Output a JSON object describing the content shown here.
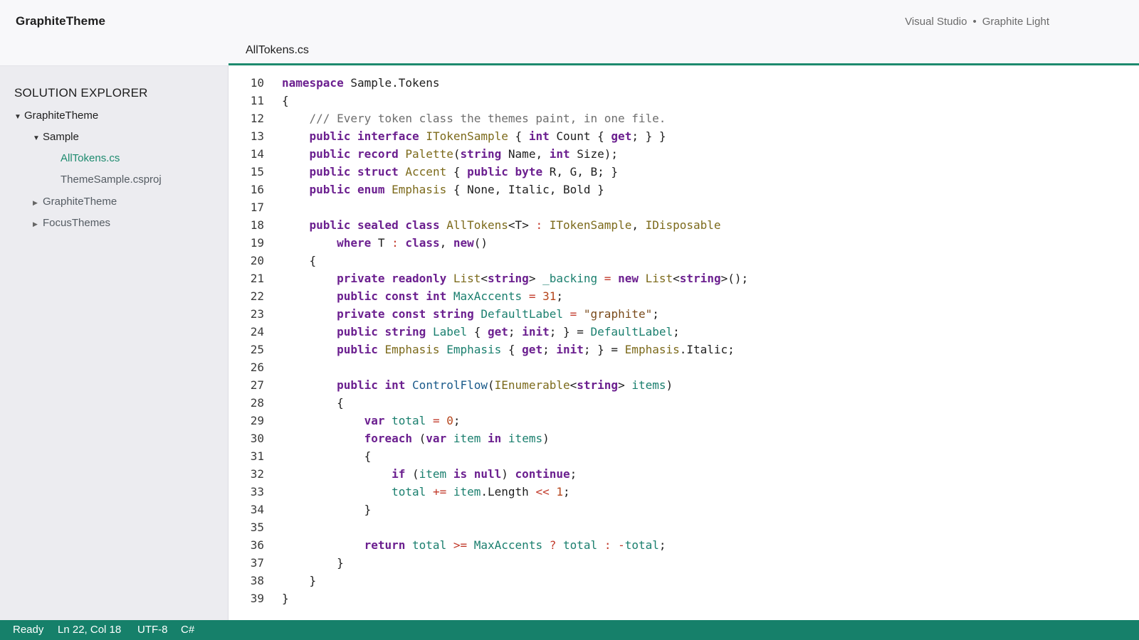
{
  "window": {
    "app_title": "GraphiteTheme",
    "ide": "Visual Studio",
    "separator": "•",
    "theme": "Graphite Light"
  },
  "tab": {
    "label": "AllTokens.cs"
  },
  "sidebar": {
    "title": "SOLUTION EXPLORER",
    "items": [
      {
        "label": "GraphiteTheme",
        "arrow": "▼"
      },
      {
        "label": "Sample",
        "arrow": "▼"
      },
      {
        "label": "AllTokens.cs",
        "arrow": ""
      },
      {
        "label": "ThemeSample.csproj",
        "arrow": ""
      },
      {
        "label": "GraphiteTheme",
        "arrow": "▶"
      },
      {
        "label": "FocusThemes",
        "arrow": "▶"
      }
    ]
  },
  "editor": {
    "lines": [
      {
        "n": "10",
        "tokens": [
          [
            "kw",
            "namespace"
          ],
          [
            "pl",
            " Sample.Tokens"
          ]
        ]
      },
      {
        "n": "11",
        "tokens": [
          [
            "pl",
            "{"
          ]
        ]
      },
      {
        "n": "12",
        "tokens": [
          [
            "com",
            "    /// Every token class the themes paint, in one file."
          ]
        ]
      },
      {
        "n": "13",
        "tokens": [
          [
            "pl",
            "    "
          ],
          [
            "kw",
            "public"
          ],
          [
            "pl",
            " "
          ],
          [
            "kw",
            "interface"
          ],
          [
            "pl",
            " "
          ],
          [
            "type",
            "ITokenSample"
          ],
          [
            "pl",
            " { "
          ],
          [
            "kw",
            "int"
          ],
          [
            "pl",
            " Count { "
          ],
          [
            "kw",
            "get"
          ],
          [
            "pl",
            "; } }"
          ]
        ]
      },
      {
        "n": "14",
        "tokens": [
          [
            "pl",
            "    "
          ],
          [
            "kw",
            "public"
          ],
          [
            "pl",
            " "
          ],
          [
            "kw",
            "record"
          ],
          [
            "pl",
            " "
          ],
          [
            "type",
            "Palette"
          ],
          [
            "pl",
            "("
          ],
          [
            "kw",
            "string"
          ],
          [
            "pl",
            " Name, "
          ],
          [
            "kw",
            "int"
          ],
          [
            "pl",
            " Size);"
          ]
        ]
      },
      {
        "n": "15",
        "tokens": [
          [
            "pl",
            "    "
          ],
          [
            "kw",
            "public"
          ],
          [
            "pl",
            " "
          ],
          [
            "kw",
            "struct"
          ],
          [
            "pl",
            " "
          ],
          [
            "type",
            "Accent"
          ],
          [
            "pl",
            " { "
          ],
          [
            "kw",
            "public"
          ],
          [
            "pl",
            " "
          ],
          [
            "kw",
            "byte"
          ],
          [
            "pl",
            " R, G, B; }"
          ]
        ]
      },
      {
        "n": "16",
        "tokens": [
          [
            "pl",
            "    "
          ],
          [
            "kw",
            "public"
          ],
          [
            "pl",
            " "
          ],
          [
            "kw",
            "enum"
          ],
          [
            "pl",
            " "
          ],
          [
            "type",
            "Emphasis"
          ],
          [
            "pl",
            " { None, Italic, Bold }"
          ]
        ]
      },
      {
        "n": "17",
        "tokens": []
      },
      {
        "n": "18",
        "tokens": [
          [
            "pl",
            "    "
          ],
          [
            "kw",
            "public"
          ],
          [
            "pl",
            " "
          ],
          [
            "kw",
            "sealed"
          ],
          [
            "pl",
            " "
          ],
          [
            "kw",
            "class"
          ],
          [
            "pl",
            " "
          ],
          [
            "type",
            "AllTokens"
          ],
          [
            "pl",
            "<T> "
          ],
          [
            "op",
            ":"
          ],
          [
            "pl",
            " "
          ],
          [
            "type",
            "ITokenSample"
          ],
          [
            "pl",
            ", "
          ],
          [
            "type",
            "IDisposable"
          ]
        ]
      },
      {
        "n": "19",
        "tokens": [
          [
            "pl",
            "        "
          ],
          [
            "kw",
            "where"
          ],
          [
            "pl",
            " T "
          ],
          [
            "op",
            ":"
          ],
          [
            "pl",
            " "
          ],
          [
            "kw",
            "class"
          ],
          [
            "pl",
            ", "
          ],
          [
            "kw",
            "new"
          ],
          [
            "pl",
            "()"
          ]
        ]
      },
      {
        "n": "20",
        "tokens": [
          [
            "pl",
            "    {"
          ]
        ]
      },
      {
        "n": "21",
        "tokens": [
          [
            "pl",
            "        "
          ],
          [
            "kw",
            "private"
          ],
          [
            "pl",
            " "
          ],
          [
            "kw",
            "readonly"
          ],
          [
            "pl",
            " "
          ],
          [
            "type",
            "List"
          ],
          [
            "pl",
            "<"
          ],
          [
            "kw",
            "string"
          ],
          [
            "pl",
            "> "
          ],
          [
            "mem",
            "_backing"
          ],
          [
            "pl",
            " "
          ],
          [
            "op",
            "="
          ],
          [
            "pl",
            " "
          ],
          [
            "kw",
            "new"
          ],
          [
            "pl",
            " "
          ],
          [
            "type",
            "List"
          ],
          [
            "pl",
            "<"
          ],
          [
            "kw",
            "string"
          ],
          [
            "pl",
            ">();"
          ]
        ]
      },
      {
        "n": "22",
        "tokens": [
          [
            "pl",
            "        "
          ],
          [
            "kw",
            "public"
          ],
          [
            "pl",
            " "
          ],
          [
            "kw",
            "const"
          ],
          [
            "pl",
            " "
          ],
          [
            "kw",
            "int"
          ],
          [
            "pl",
            " "
          ],
          [
            "mem",
            "MaxAccents"
          ],
          [
            "pl",
            " "
          ],
          [
            "op",
            "="
          ],
          [
            "pl",
            " "
          ],
          [
            "num",
            "31"
          ],
          [
            "pl",
            ";"
          ]
        ]
      },
      {
        "n": "23",
        "tokens": [
          [
            "pl",
            "        "
          ],
          [
            "kw",
            "private"
          ],
          [
            "pl",
            " "
          ],
          [
            "kw",
            "const"
          ],
          [
            "pl",
            " "
          ],
          [
            "kw",
            "string"
          ],
          [
            "pl",
            " "
          ],
          [
            "mem",
            "DefaultLabel"
          ],
          [
            "pl",
            " "
          ],
          [
            "op",
            "="
          ],
          [
            "pl",
            " "
          ],
          [
            "str",
            "\"graphite\""
          ],
          [
            "pl",
            ";"
          ]
        ]
      },
      {
        "n": "24",
        "tokens": [
          [
            "pl",
            "        "
          ],
          [
            "kw",
            "public"
          ],
          [
            "pl",
            " "
          ],
          [
            "kw",
            "string"
          ],
          [
            "pl",
            " "
          ],
          [
            "mem",
            "Label"
          ],
          [
            "pl",
            " { "
          ],
          [
            "kw",
            "get"
          ],
          [
            "pl",
            "; "
          ],
          [
            "kw",
            "init"
          ],
          [
            "pl",
            "; } = "
          ],
          [
            "mem",
            "DefaultLabel"
          ],
          [
            "pl",
            ";"
          ]
        ]
      },
      {
        "n": "25",
        "tokens": [
          [
            "pl",
            "        "
          ],
          [
            "kw",
            "public"
          ],
          [
            "pl",
            " "
          ],
          [
            "type",
            "Emphasis"
          ],
          [
            "pl",
            " "
          ],
          [
            "mem",
            "Emphasis"
          ],
          [
            "pl",
            " { "
          ],
          [
            "kw",
            "get"
          ],
          [
            "pl",
            "; "
          ],
          [
            "kw",
            "init"
          ],
          [
            "pl",
            "; } = "
          ],
          [
            "type",
            "Emphasis"
          ],
          [
            "pl",
            ".Italic;"
          ]
        ]
      },
      {
        "n": "26",
        "tokens": []
      },
      {
        "n": "27",
        "tokens": [
          [
            "pl",
            "        "
          ],
          [
            "kw",
            "public"
          ],
          [
            "pl",
            " "
          ],
          [
            "kw",
            "int"
          ],
          [
            "pl",
            " "
          ],
          [
            "meth",
            "ControlFlow"
          ],
          [
            "pl",
            "("
          ],
          [
            "type",
            "IEnumerable"
          ],
          [
            "pl",
            "<"
          ],
          [
            "kw",
            "string"
          ],
          [
            "pl",
            "> "
          ],
          [
            "mem",
            "items"
          ],
          [
            "pl",
            ")"
          ]
        ]
      },
      {
        "n": "28",
        "tokens": [
          [
            "pl",
            "        {"
          ]
        ]
      },
      {
        "n": "29",
        "tokens": [
          [
            "pl",
            "            "
          ],
          [
            "kw",
            "var"
          ],
          [
            "pl",
            " "
          ],
          [
            "mem",
            "total"
          ],
          [
            "pl",
            " "
          ],
          [
            "op",
            "="
          ],
          [
            "pl",
            " "
          ],
          [
            "num",
            "0"
          ],
          [
            "pl",
            ";"
          ]
        ]
      },
      {
        "n": "30",
        "tokens": [
          [
            "pl",
            "            "
          ],
          [
            "kw",
            "foreach"
          ],
          [
            "pl",
            " ("
          ],
          [
            "kw",
            "var"
          ],
          [
            "pl",
            " "
          ],
          [
            "mem",
            "item"
          ],
          [
            "pl",
            " "
          ],
          [
            "kw",
            "in"
          ],
          [
            "pl",
            " "
          ],
          [
            "mem",
            "items"
          ],
          [
            "pl",
            ")"
          ]
        ]
      },
      {
        "n": "31",
        "tokens": [
          [
            "pl",
            "            {"
          ]
        ]
      },
      {
        "n": "32",
        "tokens": [
          [
            "pl",
            "                "
          ],
          [
            "kw",
            "if"
          ],
          [
            "pl",
            " ("
          ],
          [
            "mem",
            "item"
          ],
          [
            "pl",
            " "
          ],
          [
            "kw",
            "is"
          ],
          [
            "pl",
            " "
          ],
          [
            "kw",
            "null"
          ],
          [
            "pl",
            ") "
          ],
          [
            "kw",
            "continue"
          ],
          [
            "pl",
            ";"
          ]
        ]
      },
      {
        "n": "33",
        "tokens": [
          [
            "pl",
            "                "
          ],
          [
            "mem",
            "total"
          ],
          [
            "pl",
            " "
          ],
          [
            "op",
            "+="
          ],
          [
            "pl",
            " "
          ],
          [
            "mem",
            "item"
          ],
          [
            "pl",
            ".Length "
          ],
          [
            "op",
            "<<"
          ],
          [
            "pl",
            " "
          ],
          [
            "num",
            "1"
          ],
          [
            "pl",
            ";"
          ]
        ]
      },
      {
        "n": "34",
        "tokens": [
          [
            "pl",
            "            }"
          ]
        ]
      },
      {
        "n": "35",
        "tokens": []
      },
      {
        "n": "36",
        "tokens": [
          [
            "pl",
            "            "
          ],
          [
            "kw",
            "return"
          ],
          [
            "pl",
            " "
          ],
          [
            "mem",
            "total"
          ],
          [
            "pl",
            " "
          ],
          [
            "op",
            ">="
          ],
          [
            "pl",
            " "
          ],
          [
            "mem",
            "MaxAccents"
          ],
          [
            "pl",
            " "
          ],
          [
            "op",
            "?"
          ],
          [
            "pl",
            " "
          ],
          [
            "mem",
            "total"
          ],
          [
            "pl",
            " "
          ],
          [
            "op",
            ":"
          ],
          [
            "pl",
            " "
          ],
          [
            "op",
            "-"
          ],
          [
            "mem",
            "total"
          ],
          [
            "pl",
            ";"
          ]
        ]
      },
      {
        "n": "37",
        "tokens": [
          [
            "pl",
            "        }"
          ]
        ]
      },
      {
        "n": "38",
        "tokens": [
          [
            "pl",
            "    }"
          ]
        ]
      },
      {
        "n": "39",
        "tokens": [
          [
            "pl",
            "}"
          ]
        ]
      }
    ]
  },
  "statusbar": {
    "state": "Ready",
    "position": "Ln 22, Col 18",
    "encoding": "UTF-8",
    "language": "C#"
  },
  "colors": {
    "accent": "#1d8a6e",
    "statusbar_bg": "#16806a",
    "keyword": "#6b1f8f",
    "type": "#7c6a1b",
    "member": "#1a7f6e",
    "method": "#1a5a8a",
    "number": "#b5451b",
    "operator": "#c23a2b",
    "comment": "#6e6e6e"
  }
}
